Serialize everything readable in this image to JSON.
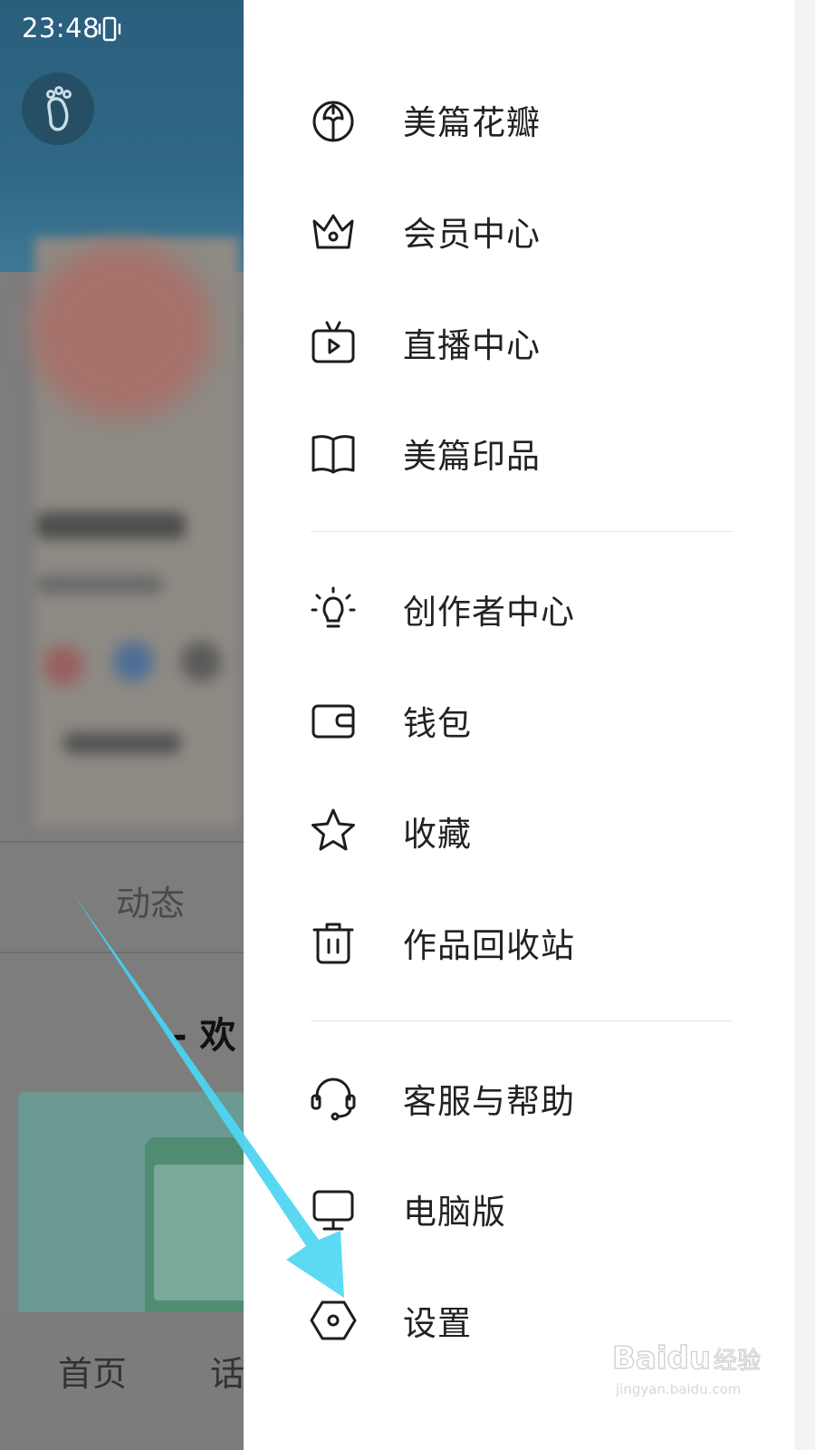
{
  "status_bar": {
    "time": "23:48"
  },
  "background": {
    "tab_label": "动态",
    "welcome_text": "- 欢",
    "nav": {
      "home": "首页",
      "second_partial": "话"
    }
  },
  "drawer": {
    "group1": [
      {
        "label": "美篇花瓣",
        "icon": "flower-petal-icon"
      },
      {
        "label": "会员中心",
        "icon": "crown-icon"
      },
      {
        "label": "直播中心",
        "icon": "tv-play-icon"
      },
      {
        "label": "美篇印品",
        "icon": "open-book-icon"
      }
    ],
    "group2": [
      {
        "label": "创作者中心",
        "icon": "lightbulb-icon"
      },
      {
        "label": "钱包",
        "icon": "wallet-icon"
      },
      {
        "label": "收藏",
        "icon": "star-icon"
      },
      {
        "label": "作品回收站",
        "icon": "trash-icon"
      }
    ],
    "group3": [
      {
        "label": "客服与帮助",
        "icon": "headset-icon"
      },
      {
        "label": "电脑版",
        "icon": "monitor-icon"
      },
      {
        "label": "设置",
        "icon": "settings-hexagon-icon"
      }
    ]
  },
  "annotation": {
    "arrow_color": "#4fd3ef"
  },
  "watermark": {
    "brand": "Baidu",
    "cn": "经验",
    "url": "jingyan.baidu.com"
  }
}
